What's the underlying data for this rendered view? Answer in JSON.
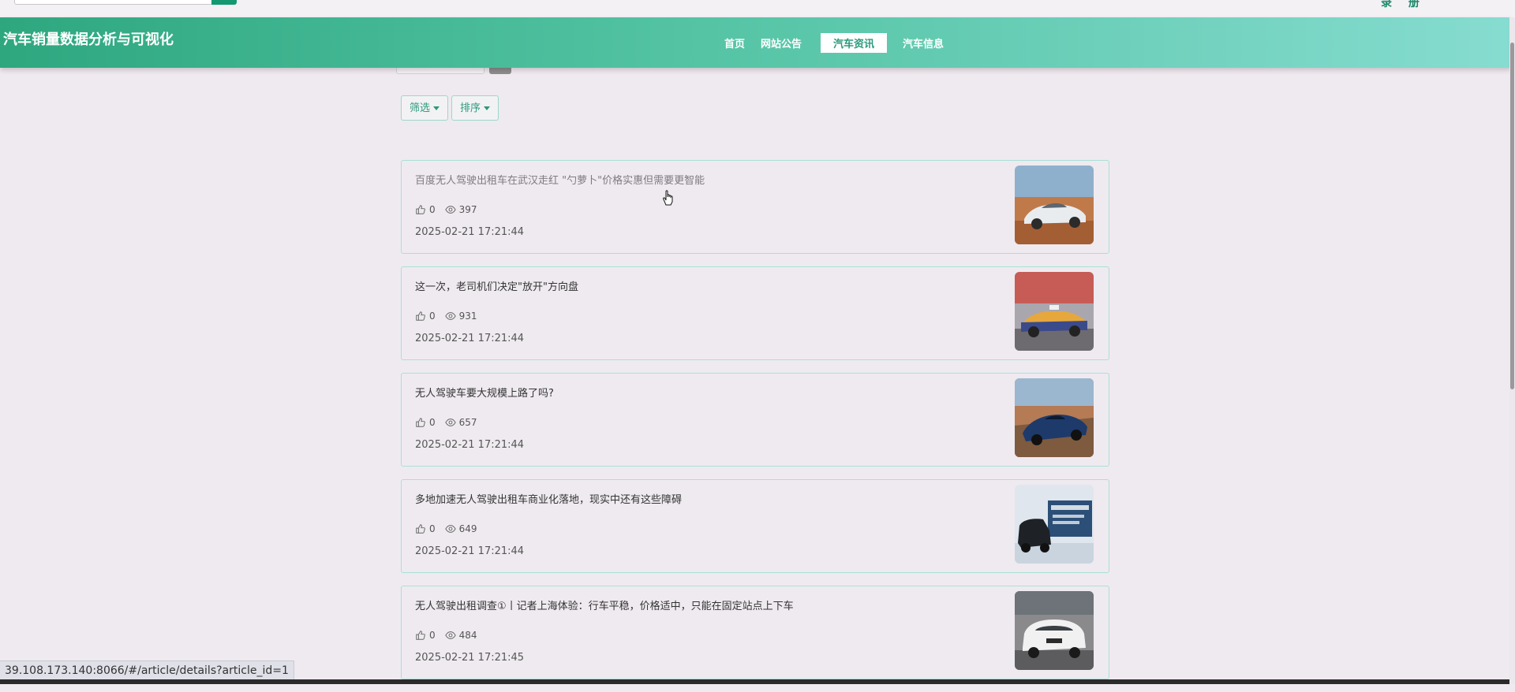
{
  "header": {
    "site_title": "汽车销量数据分析与可视化",
    "register_link": "录 册",
    "nav": [
      "首页",
      "网站公告",
      "汽车资讯",
      "汽车信息"
    ],
    "active_nav": "汽车资讯"
  },
  "toolbar": {
    "filter_label": "筛选",
    "sort_label": "排序"
  },
  "articles": [
    {
      "title": "百度无人驾驶出租车在武汉走红 \"勺萝卜\"价格实惠但需要更智能",
      "likes": "0",
      "views": "397",
      "date": "2025-02-21 17:21:44",
      "thumb": "white-sports-car"
    },
    {
      "title": "这一次，老司机们决定\"放开\"方向盘",
      "likes": "0",
      "views": "931",
      "date": "2025-02-21 17:21:44",
      "thumb": "taxi"
    },
    {
      "title": "无人驾驶车要大规模上路了吗?",
      "likes": "0",
      "views": "657",
      "date": "2025-02-21 17:21:44",
      "thumb": "blue-sports-car"
    },
    {
      "title": "多地加速无人驾驶出租车商业化落地，现实中还有这些障碍",
      "likes": "0",
      "views": "649",
      "date": "2025-02-21 17:21:44",
      "thumb": "suv-poster"
    },
    {
      "title": "无人驾驶出租调查①丨记者上海体验：行车平稳，价格适中，只能在固定站点上下车",
      "likes": "0",
      "views": "484",
      "date": "2025-02-21 17:21:45",
      "thumb": "white-suv"
    }
  ],
  "status_url": "39.108.173.140:8066/#/article/details?article_id=1",
  "colors": {
    "accent": "#2a9a7b",
    "border": "#a9e0d6",
    "background": "#efeaf0"
  },
  "icons": {
    "like": "thumbs-up-icon",
    "view": "eye-icon"
  }
}
